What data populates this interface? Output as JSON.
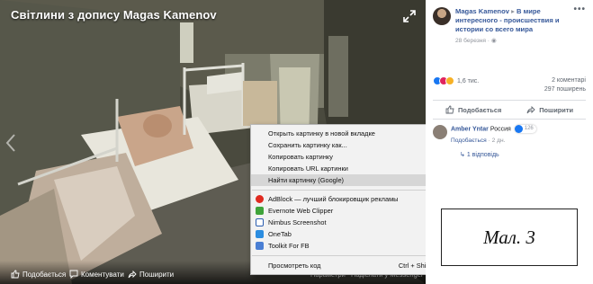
{
  "viewer": {
    "title": "Світлини з допису Magas Kamenov",
    "bottom_bar": {
      "like": "Подобається",
      "comment": "Коментувати",
      "share": "Поширити",
      "params": "Параметри",
      "messenger": "Надіслати у Messenger"
    }
  },
  "context_menu": {
    "items": [
      {
        "label": "Открыть картинку в новой вкладке"
      },
      {
        "label": "Сохранить картинку как..."
      },
      {
        "label": "Копировать картинку"
      },
      {
        "label": "Копировать URL картинки"
      },
      {
        "label": "Найти картинку (Google)"
      },
      {
        "label": "AdBlock — лучший блокировщик рекламы"
      },
      {
        "label": "Evernote Web Clipper"
      },
      {
        "label": "Nimbus Screenshot"
      },
      {
        "label": "OneTab"
      },
      {
        "label": "Toolkit For FB"
      },
      {
        "label": "Просмотреть код",
        "shortcut": "Ctrl + Shift + I"
      }
    ],
    "highlighted_index": 4,
    "submenu_arrow": "▶"
  },
  "panel": {
    "author": "Magas Kamenov",
    "separator": "▸",
    "group": "В мире интересного - происшествия и истории со всего мира",
    "date": "28 березня · ",
    "dots": "•••",
    "reactions_count": "1,6 тис.",
    "comments": "2 коментарі",
    "shares": "297 поширень",
    "like_label": "Подобається",
    "share_label": "Поширити",
    "comment": {
      "name": "Amber Yntar",
      "text": " Россия",
      "badge_count": "126",
      "like_link": "Подобається",
      "time": " · 2 дн.",
      "reply": "1 відповідь"
    }
  },
  "caption": "Мал. 3",
  "colors": {
    "fb_blue": "#365899",
    "highlight": "#d6d6d6",
    "menu_bg": "#f2f2f2"
  }
}
